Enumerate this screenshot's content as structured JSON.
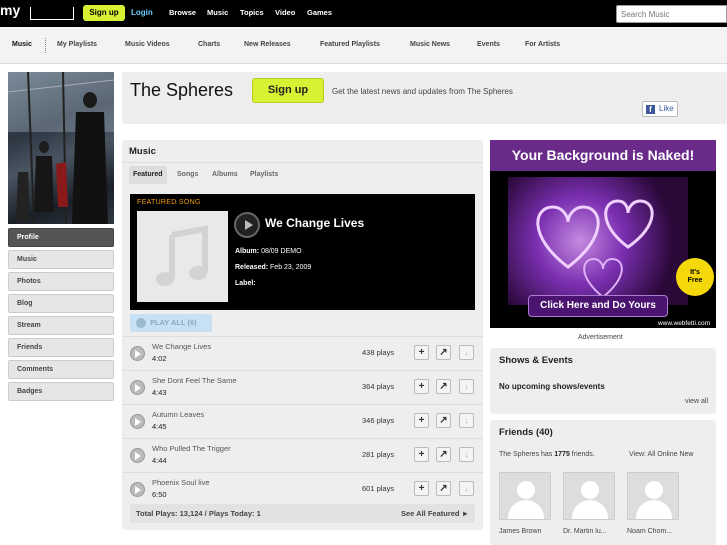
{
  "topbar": {
    "logo": "my",
    "signup": "Sign up",
    "login": "Login",
    "nav": [
      "Browse",
      "Music",
      "Topics",
      "Video",
      "Games"
    ],
    "search_placeholder": "Search Music"
  },
  "subnav": {
    "items": [
      "Music",
      "My Playlists",
      "Music Videos",
      "Charts",
      "New Releases",
      "Featured Playlists",
      "Music News",
      "Events",
      "For Artists"
    ]
  },
  "left_menu": [
    "Profile",
    "Music",
    "Photos",
    "Blog",
    "Stream",
    "Friends",
    "Comments",
    "Badges"
  ],
  "header": {
    "artist_name": "The Spheres",
    "signup": "Sign up",
    "tagline": "Get the latest news and updates from The Spheres",
    "like": "Like",
    "fb": "f"
  },
  "music": {
    "title": "Music",
    "tabs": [
      "Featured",
      "Songs",
      "Albums",
      "Playlists"
    ],
    "featured": {
      "label": "FEATURED SONG",
      "title": "We Change Lives",
      "album_label": "Album:",
      "album": "08/09 DEMO",
      "released_label": "Released:",
      "released": "Feb 23, 2009",
      "label_label": "Label:",
      "label_value": ""
    },
    "play_all": "PLAY ALL (6)",
    "tracks": [
      {
        "title": "We Change Lives",
        "duration": "4:02",
        "plays": "438 plays"
      },
      {
        "title": "She Dont Feel The Same",
        "duration": "4:43",
        "plays": "364 plays"
      },
      {
        "title": "Autumn Leaves",
        "duration": "4:45",
        "plays": "346 plays"
      },
      {
        "title": "Who Pulled The Trigger",
        "duration": "4:44",
        "plays": "281 plays"
      },
      {
        "title": "Phoenix Soul live",
        "duration": "6:50",
        "plays": "601 plays"
      }
    ],
    "totals": "Total Plays: 13,124 / Plays Today: 1",
    "see_all": "See All Featured ►"
  },
  "ad": {
    "headline": "Your Background is Naked!",
    "badge_line1": "It's",
    "badge_line2": "Free",
    "cta": "Click Here and Do Yours",
    "url": "www.webfetti.com",
    "label": "Advertisement"
  },
  "shows": {
    "title": "Shows & Events",
    "empty": "No upcoming shows/events",
    "view_all": "view all"
  },
  "friends": {
    "title": "Friends (40)",
    "summary_prefix": "The Spheres has",
    "count": "1775",
    "summary_suffix": "friends.",
    "view": "View:  All  Online  New",
    "list": [
      "James Brown",
      "Dr. Martin lu...",
      "Noam Chom..."
    ]
  }
}
